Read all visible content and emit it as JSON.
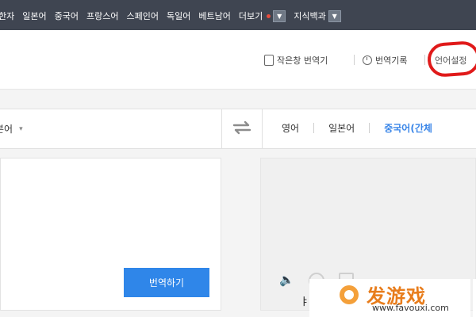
{
  "top_nav": {
    "items": [
      {
        "label": "한자",
        "has_dot": false,
        "has_dropdown": false
      },
      {
        "label": "일본어",
        "has_dot": false,
        "has_dropdown": false
      },
      {
        "label": "중국어",
        "has_dot": false,
        "has_dropdown": false
      },
      {
        "label": "프랑스어",
        "has_dot": false,
        "has_dropdown": false
      },
      {
        "label": "스페인어",
        "has_dot": false,
        "has_dropdown": false
      },
      {
        "label": "독일어",
        "has_dot": false,
        "has_dropdown": false
      },
      {
        "label": "베트남어",
        "has_dot": false,
        "has_dropdown": false
      },
      {
        "label": "더보기",
        "has_dot": true,
        "has_dropdown": true
      },
      {
        "label": "지식백과",
        "has_dot": false,
        "has_dropdown": true
      }
    ],
    "dropdown_glyph": "▼",
    "colors": {
      "background": "#3f4551",
      "dot": "#e74c3c"
    }
  },
  "toolbar": {
    "phone_translator_label": "작은창 번역기",
    "history_label": "번역기록",
    "settings_label": "언어설정",
    "highlight_color": "#e01a1a"
  },
  "lang_bar": {
    "source_language": "본어",
    "caret": "▾",
    "swap_glyph": "⇄",
    "targets": [
      {
        "label": "영어",
        "active": false
      },
      {
        "label": "일본어",
        "active": false
      },
      {
        "label": "중국어(간체",
        "active": true
      }
    ],
    "active_color": "#3a86e8"
  },
  "source": {
    "translate_button": "번역하기",
    "button_color": "#2f86e9"
  },
  "output": {
    "icons": [
      "speaker-icon",
      "copy-icon",
      "share-icon",
      "more-icon"
    ],
    "speaker_glyph": "🔈"
  },
  "watermark": {
    "left_char": "ㅑ",
    "logo_text": "发游戏",
    "url": "www.favouxi.com",
    "logo_color": "#e87d1c"
  }
}
